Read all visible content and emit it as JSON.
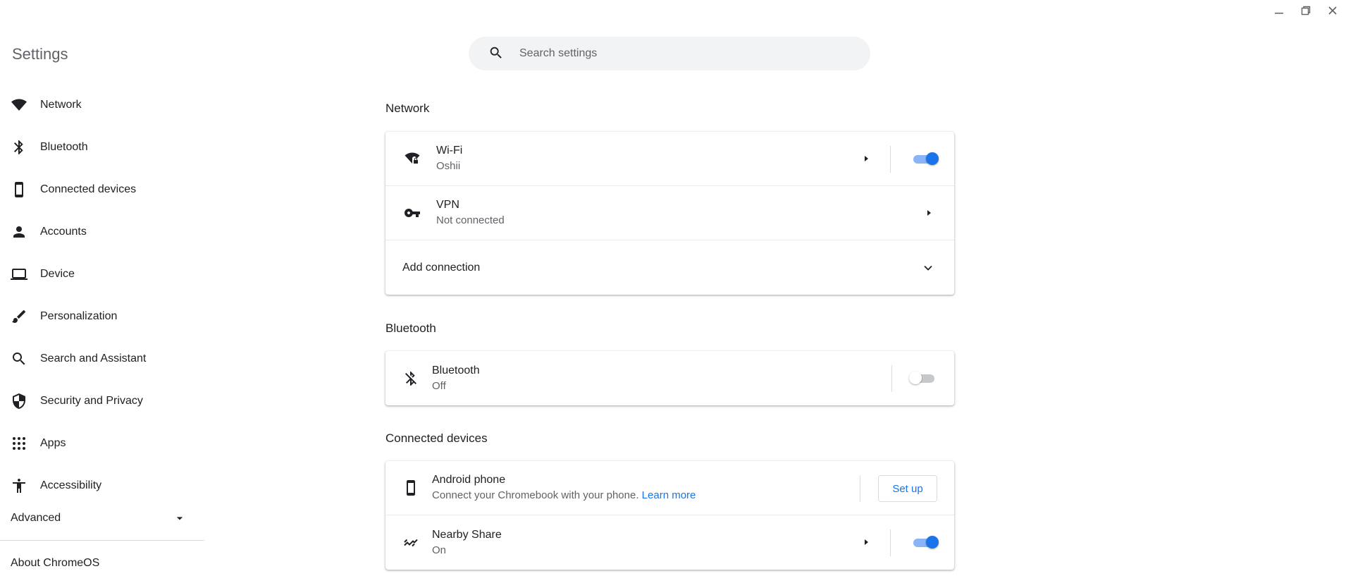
{
  "app": {
    "title": "Settings"
  },
  "window": {
    "minimize": "minimize",
    "restore": "restore",
    "close": "close"
  },
  "search": {
    "placeholder": "Search settings"
  },
  "sidebar": {
    "items": [
      {
        "label": "Network",
        "icon": "wifi-icon"
      },
      {
        "label": "Bluetooth",
        "icon": "bluetooth-icon"
      },
      {
        "label": "Connected devices",
        "icon": "phone-icon"
      },
      {
        "label": "Accounts",
        "icon": "person-icon"
      },
      {
        "label": "Device",
        "icon": "laptop-icon"
      },
      {
        "label": "Personalization",
        "icon": "brush-icon"
      },
      {
        "label": "Search and Assistant",
        "icon": "search-icon"
      },
      {
        "label": "Security and Privacy",
        "icon": "shield-icon"
      },
      {
        "label": "Apps",
        "icon": "apps-grid-icon"
      },
      {
        "label": "Accessibility",
        "icon": "accessibility-icon"
      }
    ],
    "advanced": "Advanced",
    "about": "About ChromeOS"
  },
  "network": {
    "title": "Network",
    "wifi": {
      "title": "Wi-Fi",
      "subtitle": "Oshii",
      "enabled": true
    },
    "vpn": {
      "title": "VPN",
      "subtitle": "Not connected"
    },
    "add_connection": "Add connection"
  },
  "bluetooth": {
    "title": "Bluetooth",
    "row": {
      "title": "Bluetooth",
      "subtitle": "Off",
      "enabled": false
    }
  },
  "connected_devices": {
    "title": "Connected devices",
    "android": {
      "title": "Android phone",
      "subtitle": "Connect your Chromebook with your phone.",
      "link": "Learn more",
      "button": "Set up"
    },
    "nearby": {
      "title": "Nearby Share",
      "subtitle": "On",
      "enabled": true
    }
  },
  "colors": {
    "accent": "#1a73e8",
    "toggle_track_on": "#8ab4f8",
    "toggle_off": "#c6c9cc"
  }
}
